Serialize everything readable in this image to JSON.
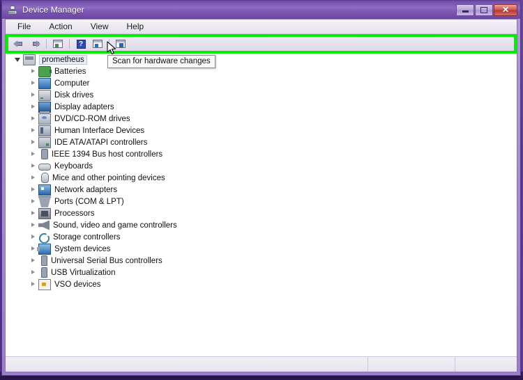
{
  "window": {
    "title": "Device Manager",
    "title_icon": "device-manager-icon",
    "controls": {
      "minimize": "–",
      "maximize": "□",
      "close": "✕"
    }
  },
  "menubar": {
    "items": [
      {
        "label": "File"
      },
      {
        "label": "Action"
      },
      {
        "label": "View"
      },
      {
        "label": "Help"
      }
    ]
  },
  "toolbar": {
    "highlight_color": "#00ef00",
    "buttons": [
      {
        "name": "back-button",
        "icon": "back-arrow-icon",
        "label": "Back"
      },
      {
        "name": "forward-button",
        "icon": "forward-arrow-icon",
        "label": "Forward"
      },
      {
        "name": "show-hide-console-tree-button",
        "icon": "console-tree-icon",
        "label": "Show/Hide Console Tree"
      },
      {
        "name": "help-button",
        "icon": "help-question-icon",
        "label": "?"
      },
      {
        "name": "properties-button",
        "icon": "properties-icon",
        "label": "Properties"
      },
      {
        "name": "scan-hardware-button",
        "icon": "scan-hardware-icon",
        "label": "Scan for hardware changes"
      }
    ]
  },
  "tooltip": {
    "text": "Scan for hardware changes"
  },
  "tree": {
    "root": {
      "label": "prometheus",
      "icon": "computer-icon",
      "expanded": true,
      "selected": true
    },
    "items": [
      {
        "label": "Batteries",
        "icon": "battery-icon"
      },
      {
        "label": "Computer",
        "icon": "computer-node-icon"
      },
      {
        "label": "Disk drives",
        "icon": "disk-drive-icon"
      },
      {
        "label": "Display adapters",
        "icon": "display-adapter-icon"
      },
      {
        "label": "DVD/CD-ROM drives",
        "icon": "dvd-drive-icon"
      },
      {
        "label": "Human Interface Devices",
        "icon": "hid-icon"
      },
      {
        "label": "IDE ATA/ATAPI controllers",
        "icon": "ide-controller-icon"
      },
      {
        "label": "IEEE 1394 Bus host controllers",
        "icon": "ieee1394-icon"
      },
      {
        "label": "Keyboards",
        "icon": "keyboard-icon"
      },
      {
        "label": "Mice and other pointing devices",
        "icon": "mouse-icon"
      },
      {
        "label": "Network adapters",
        "icon": "network-adapter-icon"
      },
      {
        "label": "Ports (COM & LPT)",
        "icon": "port-icon"
      },
      {
        "label": "Processors",
        "icon": "processor-icon"
      },
      {
        "label": "Sound, video and game controllers",
        "icon": "sound-icon"
      },
      {
        "label": "Storage controllers",
        "icon": "storage-controller-icon"
      },
      {
        "label": "System devices",
        "icon": "system-device-icon"
      },
      {
        "label": "Universal Serial Bus controllers",
        "icon": "usb-controller-icon"
      },
      {
        "label": "USB Virtualization",
        "icon": "usb-virtualization-icon"
      },
      {
        "label": "VSO devices",
        "icon": "vso-device-icon"
      }
    ]
  },
  "statusbar": {
    "main": "",
    "panel2": "",
    "panel3": ""
  }
}
